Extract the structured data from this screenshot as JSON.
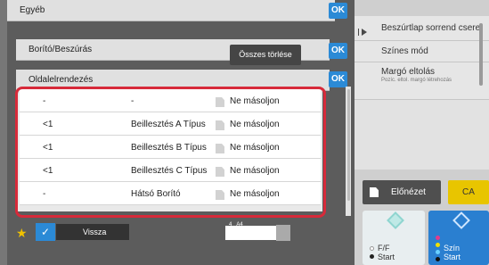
{
  "screen": {
    "title": "Egyéb",
    "sections": [
      {
        "label": "Borító/Beszúrás",
        "ok": "OK"
      },
      {
        "label": "Oldalelrendezés",
        "ok": "OK"
      }
    ],
    "top_ok": "OK",
    "clear_all": "Összes törlése",
    "table_rows": [
      {
        "col1": "-",
        "col2": "-",
        "icon": "page-icon",
        "col4": "Ne másoljon"
      },
      {
        "col1": "<1",
        "col2": "Beillesztés A Típus",
        "icon": "page-icon",
        "col4": "Ne másoljon"
      },
      {
        "col1": "<1",
        "col2": "Beillesztés B Típus",
        "icon": "page-icon",
        "col4": "Ne másoljon"
      },
      {
        "col1": "<1",
        "col2": "Beillesztés C Típus",
        "icon": "page-icon",
        "col4": "Ne másoljon"
      },
      {
        "col1": "-",
        "col2": "Hátsó Borító",
        "icon": "page-icon",
        "col4": "Ne másoljon"
      }
    ],
    "highlight_color": "#d72a3a"
  },
  "right_panel": {
    "items": [
      {
        "label": "Beszúrtlap sorrend csere"
      },
      {
        "label": "Színes mód"
      },
      {
        "label": "Margó eltolás",
        "sublabel": "Pozíc. eltol. margó létrehozás"
      }
    ],
    "preview": "Előnézet",
    "ca": "CA",
    "ff_label": "F/F",
    "ff_start": "Start",
    "color_label": "Szín",
    "color_start": "Start"
  },
  "toolbar": {
    "back": "Vissza",
    "page_num": "4",
    "paper": "A4"
  }
}
